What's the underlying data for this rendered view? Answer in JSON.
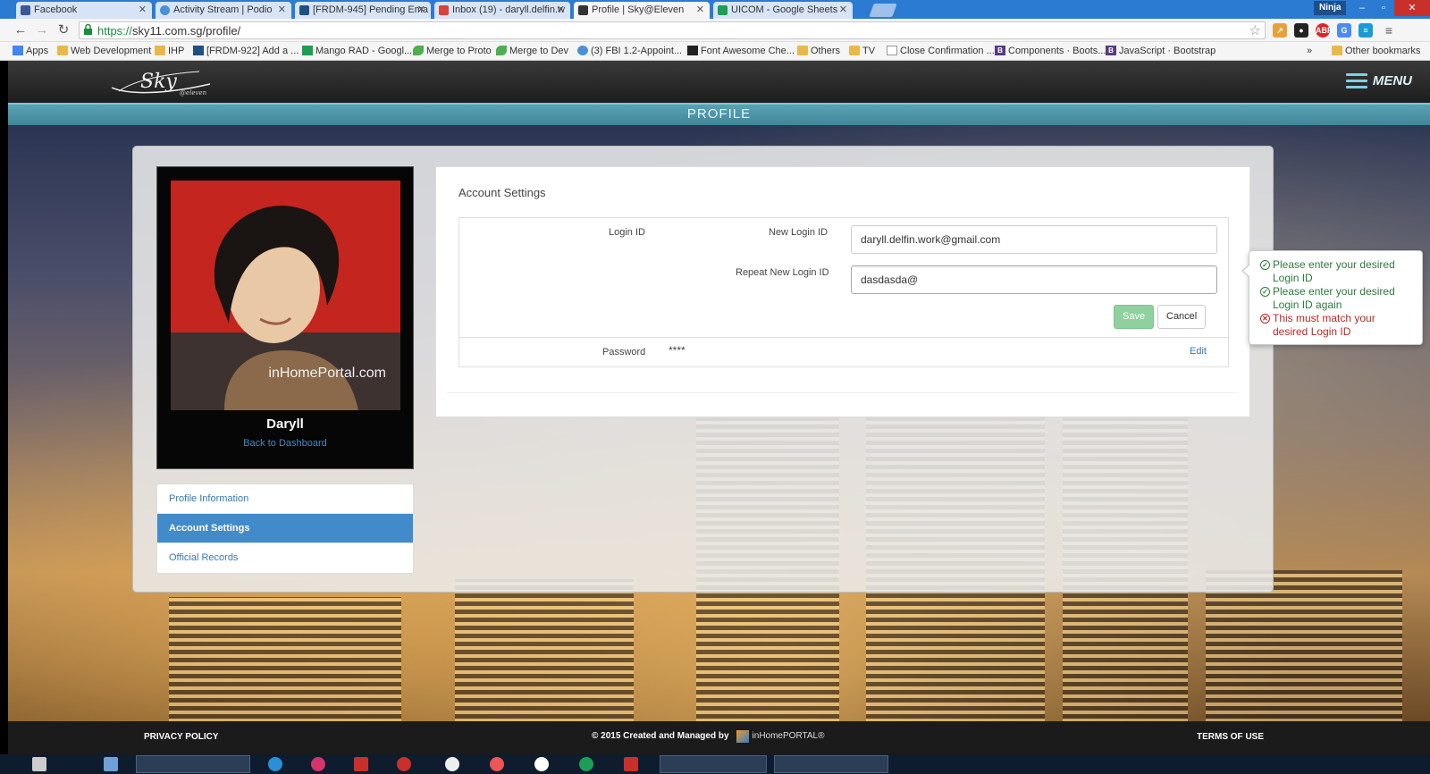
{
  "browser": {
    "tabs": [
      {
        "label": "Facebook",
        "color": "#3b5998"
      },
      {
        "label": "Activity Stream | Podio",
        "color": "#4a90d9"
      },
      {
        "label": "[FRDM-945] Pending Ema",
        "color": "#205081"
      },
      {
        "label": "Inbox (19) - daryll.delfin.w",
        "color": "#d44638"
      },
      {
        "label": "Profile | Sky@Eleven",
        "color": "#333333"
      },
      {
        "label": "UICOM - Google Sheets",
        "color": "#1e9e55"
      }
    ],
    "profile_label": "Ninja",
    "url_scheme": "https://",
    "url_rest": "sky11.com.sg/profile/",
    "bookmarks": [
      {
        "label": "Apps",
        "icon": "apps-icon"
      },
      {
        "label": "Web Development",
        "icon": "folder-icon"
      },
      {
        "label": "IHP",
        "icon": "folder-icon"
      },
      {
        "label": "[FRDM-922] Add a ...",
        "icon": "jira-icon"
      },
      {
        "label": "Mango RAD - Googl...",
        "icon": "sheet-icon"
      },
      {
        "label": "Merge to Proto",
        "icon": "leaf-icon"
      },
      {
        "label": "Merge to Dev",
        "icon": "leaf-icon"
      },
      {
        "label": "(3) FBI 1.2-Appoint...",
        "icon": "podio-icon"
      },
      {
        "label": "Font Awesome Che...",
        "icon": "flag-icon"
      },
      {
        "label": "Others",
        "icon": "folder-icon"
      },
      {
        "label": "TV",
        "icon": "folder-icon"
      },
      {
        "label": "Close Confirmation ...",
        "icon": "page-icon"
      },
      {
        "label": "Components · Boots...",
        "icon": "bootstrap-icon"
      },
      {
        "label": "JavaScript · Bootstrap",
        "icon": "bootstrap-icon"
      }
    ],
    "bookmarks_overflow": "»",
    "other_bookmarks": "Other bookmarks"
  },
  "site": {
    "logo_text": "Sky",
    "logo_sub": "@eleven",
    "menu_label": "MENU",
    "page_title": "PROFILE"
  },
  "profile": {
    "name": "Daryll",
    "back_link": "Back to Dashboard",
    "watermark": "inHomePortal.com"
  },
  "side_nav": [
    {
      "label": "Profile Information",
      "active": false
    },
    {
      "label": "Account Settings",
      "active": true
    },
    {
      "label": "Official Records",
      "active": false
    }
  ],
  "account_settings": {
    "title": "Account Settings",
    "login_id_label": "Login ID",
    "new_login_id_label": "New Login ID",
    "new_login_id_value": "daryll.delfin.work@gmail.com",
    "repeat_login_id_label": "Repeat New Login ID",
    "repeat_login_id_value": "dasdasda@",
    "save_label": "Save",
    "cancel_label": "Cancel",
    "password_label": "Password",
    "password_value": "****",
    "edit_label": "Edit"
  },
  "validation": [
    {
      "status": "ok",
      "text": "Please enter your desired Login ID"
    },
    {
      "status": "ok",
      "text": "Please enter your desired Login ID again"
    },
    {
      "status": "error",
      "text": "This must match your desired Login ID"
    }
  ],
  "footer": {
    "privacy": "PRIVACY POLICY",
    "created": "© 2015 Created and Managed by",
    "brand": "inHomePORTAL®",
    "terms": "TERMS OF USE"
  },
  "colors": {
    "accent": "#428bca",
    "band": "#4a95a8",
    "save_disabled": "#8fd19e",
    "error": "#b52b27",
    "ok": "#2d7a3e"
  }
}
